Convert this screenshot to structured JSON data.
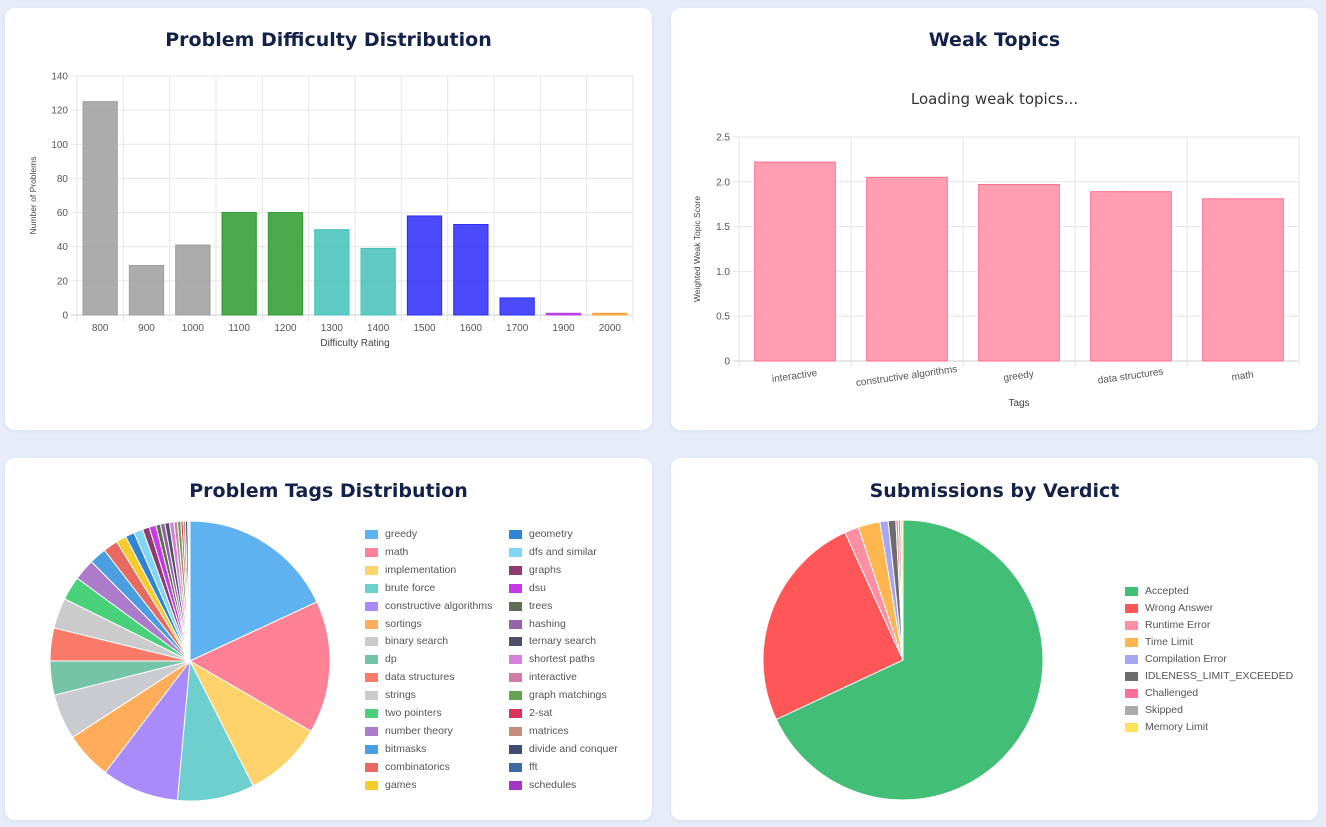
{
  "difficulty": {
    "title": "Problem Difficulty Distribution",
    "chart_data": {
      "type": "bar",
      "categories": [
        "800",
        "900",
        "1000",
        "1100",
        "1200",
        "1300",
        "1400",
        "1500",
        "1600",
        "1700",
        "1900",
        "2000"
      ],
      "values": [
        125,
        29,
        41,
        60,
        60,
        50,
        39,
        58,
        53,
        10,
        1,
        1
      ],
      "colors": [
        "#9e9e9e",
        "#9e9e9e",
        "#9e9e9e",
        "#2e9a2e",
        "#2e9a2e",
        "#43c2b8",
        "#43c2b8",
        "#2b2bfa",
        "#2b2bfa",
        "#2b2bfa",
        "#b43ce6",
        "#f7a03c"
      ],
      "xlabel": "Difficulty Rating",
      "ylabel": "Number of Problems",
      "ylim": [
        0,
        140
      ],
      "yticks": [
        "0",
        "20",
        "40",
        "60",
        "80",
        "100",
        "120",
        "140"
      ],
      "grid": true
    }
  },
  "weak": {
    "title": "Weak Topics",
    "loading_text": "Loading weak topics...",
    "chart_data": {
      "type": "bar",
      "categories": [
        "interactive",
        "constructive algorithms",
        "greedy",
        "data structures",
        "math"
      ],
      "values": [
        2.22,
        2.05,
        1.97,
        1.89,
        1.81
      ],
      "color": "#ff9eb3",
      "border_color": "#ff6f8f",
      "xlabel": "Tags",
      "ylabel": "Weighted Weak Topic Score",
      "ylim": [
        0,
        2.5
      ],
      "yticks": [
        "0",
        "0.5",
        "1.0",
        "1.5",
        "2.0",
        "2.5"
      ],
      "grid": true
    }
  },
  "tags": {
    "title": "Problem Tags Distribution",
    "chart_data": {
      "type": "pie",
      "legend_position": "right",
      "labels": [
        "greedy",
        "math",
        "implementation",
        "brute force",
        "constructive algorithms",
        "sortings",
        "binary search",
        "dp",
        "data structures",
        "strings",
        "two pointers",
        "number theory",
        "bitmasks",
        "combinatorics",
        "games",
        "geometry",
        "dfs and similar",
        "graphs",
        "dsu",
        "trees",
        "hashing",
        "ternary search",
        "shortest paths",
        "interactive",
        "graph matchings",
        "2-sat",
        "matrices",
        "divide and conquer",
        "fft",
        "schedules"
      ],
      "values": [
        138,
        117,
        70,
        68,
        68,
        42,
        40,
        30,
        29,
        27,
        21,
        19,
        15,
        13,
        9,
        8,
        8,
        6,
        6,
        4,
        4,
        4,
        4,
        3,
        3,
        2,
        2,
        2,
        1,
        1
      ],
      "colors": [
        "#5fb2f0",
        "#ff8196",
        "#ffd36b",
        "#6ecfcf",
        "#a98bfa",
        "#ffad5b",
        "#cacbcf",
        "#76c4a8",
        "#fa7a6a",
        "#cbcbcb",
        "#48d17a",
        "#ac7cca",
        "#4b9ee0",
        "#e8695f",
        "#f6cb2e",
        "#2f85d3",
        "#82d6f5",
        "#8e3b6d",
        "#c53be8",
        "#5f6e55",
        "#9563a9",
        "#4d5066",
        "#d482da",
        "#cc7ea6",
        "#68a24e",
        "#d8335f",
        "#c48d7c",
        "#3f4c73",
        "#3d6aa3",
        "#a536c3"
      ]
    }
  },
  "verdicts": {
    "title": "Submissions by Verdict",
    "chart_data": {
      "type": "pie",
      "legend_position": "right",
      "labels": [
        "Accepted",
        "Wrong Answer",
        "Runtime Error",
        "Time Limit",
        "Compilation Error",
        "IDLENESS_LIMIT_EXCEEDED",
        "Challenged",
        "Skipped",
        "Memory Limit"
      ],
      "values": [
        1000,
        370,
        24,
        37,
        14,
        13,
        4,
        4,
        4
      ],
      "colors": [
        "#43be76",
        "#ff5757",
        "#ff8fa3",
        "#ffb64f",
        "#a7a6f3",
        "#6d6d6d",
        "#ff6f9c",
        "#aaaaaa",
        "#ffe15a"
      ]
    }
  }
}
